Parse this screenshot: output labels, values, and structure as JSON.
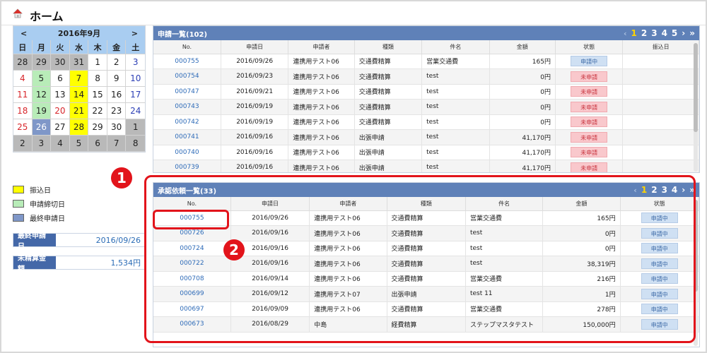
{
  "header": {
    "title": "ホーム"
  },
  "calendar": {
    "prev": "<",
    "title": "2016年9月",
    "next": ">",
    "dows": [
      "日",
      "月",
      "火",
      "水",
      "木",
      "金",
      "土"
    ],
    "cells": [
      {
        "d": "28",
        "bg": "gray",
        "t": ""
      },
      {
        "d": "29",
        "bg": "gray",
        "t": ""
      },
      {
        "d": "30",
        "bg": "gray",
        "t": ""
      },
      {
        "d": "31",
        "bg": "gray",
        "t": ""
      },
      {
        "d": "1",
        "bg": "",
        "t": ""
      },
      {
        "d": "2",
        "bg": "",
        "t": ""
      },
      {
        "d": "3",
        "bg": "",
        "t": "blue"
      },
      {
        "d": "4",
        "bg": "",
        "t": "red"
      },
      {
        "d": "5",
        "bg": "green",
        "t": ""
      },
      {
        "d": "6",
        "bg": "",
        "t": ""
      },
      {
        "d": "7",
        "bg": "yellow",
        "t": ""
      },
      {
        "d": "8",
        "bg": "",
        "t": ""
      },
      {
        "d": "9",
        "bg": "",
        "t": ""
      },
      {
        "d": "10",
        "bg": "",
        "t": "blue"
      },
      {
        "d": "11",
        "bg": "",
        "t": "red"
      },
      {
        "d": "12",
        "bg": "green",
        "t": ""
      },
      {
        "d": "13",
        "bg": "",
        "t": ""
      },
      {
        "d": "14",
        "bg": "yellow",
        "t": ""
      },
      {
        "d": "15",
        "bg": "",
        "t": ""
      },
      {
        "d": "16",
        "bg": "",
        "t": ""
      },
      {
        "d": "17",
        "bg": "",
        "t": "blue"
      },
      {
        "d": "18",
        "bg": "",
        "t": "red"
      },
      {
        "d": "19",
        "bg": "green",
        "t": ""
      },
      {
        "d": "20",
        "bg": "",
        "t": "red"
      },
      {
        "d": "21",
        "bg": "yellow",
        "t": ""
      },
      {
        "d": "22",
        "bg": "",
        "t": ""
      },
      {
        "d": "23",
        "bg": "",
        "t": ""
      },
      {
        "d": "24",
        "bg": "",
        "t": "blue"
      },
      {
        "d": "25",
        "bg": "",
        "t": "red"
      },
      {
        "d": "26",
        "bg": "blue",
        "t": ""
      },
      {
        "d": "27",
        "bg": "",
        "t": ""
      },
      {
        "d": "28",
        "bg": "yellow",
        "t": ""
      },
      {
        "d": "29",
        "bg": "",
        "t": ""
      },
      {
        "d": "30",
        "bg": "",
        "t": ""
      },
      {
        "d": "1",
        "bg": "gray",
        "t": ""
      },
      {
        "d": "2",
        "bg": "gray",
        "t": ""
      },
      {
        "d": "3",
        "bg": "gray",
        "t": ""
      },
      {
        "d": "4",
        "bg": "gray",
        "t": ""
      },
      {
        "d": "5",
        "bg": "gray",
        "t": ""
      },
      {
        "d": "6",
        "bg": "gray",
        "t": ""
      },
      {
        "d": "7",
        "bg": "gray",
        "t": ""
      },
      {
        "d": "8",
        "bg": "gray",
        "t": ""
      }
    ]
  },
  "legend": [
    {
      "label": "振込日",
      "color": "#ffff00"
    },
    {
      "label": "申請締切日",
      "color": "#b8ecb8"
    },
    {
      "label": "最終申請日",
      "color": "#7f97c8"
    }
  ],
  "info": {
    "last_applied_label": "最終申請日",
    "last_applied_value": "2016/09/26",
    "unsettled_label": "未精算金額",
    "unsettled_value": "1,534円"
  },
  "applications": {
    "title": "申請一覧(102)",
    "pager": [
      "‹",
      "1",
      "2",
      "3",
      "4",
      "5",
      "›",
      "»"
    ],
    "columns": [
      "No.",
      "申請日",
      "申請者",
      "種類",
      "件名",
      "金額",
      "状態",
      "振込日"
    ],
    "rows": [
      {
        "no": "000755",
        "date": "2016/09/26",
        "applicant": "連携用テスト06",
        "type": "交通費精算",
        "subject": "営業交通費",
        "amount": "165円",
        "status": "申請中",
        "st": "blue",
        "pay": ""
      },
      {
        "no": "000754",
        "date": "2016/09/23",
        "applicant": "連携用テスト06",
        "type": "交通費精算",
        "subject": "test",
        "amount": "0円",
        "status": "未申請",
        "st": "pink",
        "pay": ""
      },
      {
        "no": "000747",
        "date": "2016/09/21",
        "applicant": "連携用テスト06",
        "type": "交通費精算",
        "subject": "test",
        "amount": "0円",
        "status": "未申請",
        "st": "pink",
        "pay": ""
      },
      {
        "no": "000743",
        "date": "2016/09/19",
        "applicant": "連携用テスト06",
        "type": "交通費精算",
        "subject": "test",
        "amount": "0円",
        "status": "未申請",
        "st": "pink",
        "pay": ""
      },
      {
        "no": "000742",
        "date": "2016/09/19",
        "applicant": "連携用テスト06",
        "type": "交通費精算",
        "subject": "test",
        "amount": "0円",
        "status": "未申請",
        "st": "pink",
        "pay": ""
      },
      {
        "no": "000741",
        "date": "2016/09/16",
        "applicant": "連携用テスト06",
        "type": "出張申請",
        "subject": "test",
        "amount": "41,170円",
        "status": "未申請",
        "st": "pink",
        "pay": ""
      },
      {
        "no": "000740",
        "date": "2016/09/16",
        "applicant": "連携用テスト06",
        "type": "出張申請",
        "subject": "test",
        "amount": "41,170円",
        "status": "未申請",
        "st": "pink",
        "pay": ""
      },
      {
        "no": "000739",
        "date": "2016/09/16",
        "applicant": "連携用テスト06",
        "type": "出張申請",
        "subject": "test",
        "amount": "41,170円",
        "status": "未申請",
        "st": "pink",
        "pay": ""
      }
    ]
  },
  "approvals": {
    "title": "承認依頼一覧(33)",
    "pager": [
      "‹",
      "1",
      "2",
      "3",
      "4",
      "›",
      "»"
    ],
    "columns": [
      "No.",
      "申請日",
      "申請者",
      "種類",
      "件名",
      "金額",
      "状態"
    ],
    "rows": [
      {
        "no": "000755",
        "date": "2016/09/26",
        "applicant": "連携用テスト06",
        "type": "交通費精算",
        "subject": "営業交通費",
        "amount": "165円",
        "status": "申請中"
      },
      {
        "no": "000726",
        "date": "2016/09/16",
        "applicant": "連携用テスト06",
        "type": "交通費精算",
        "subject": "test",
        "amount": "0円",
        "status": "申請中"
      },
      {
        "no": "000724",
        "date": "2016/09/16",
        "applicant": "連携用テスト06",
        "type": "交通費精算",
        "subject": "test",
        "amount": "0円",
        "status": "申請中"
      },
      {
        "no": "000722",
        "date": "2016/09/16",
        "applicant": "連携用テスト06",
        "type": "交通費精算",
        "subject": "test",
        "amount": "38,319円",
        "status": "申請中"
      },
      {
        "no": "000708",
        "date": "2016/09/14",
        "applicant": "連携用テスト06",
        "type": "交通費精算",
        "subject": "営業交通費",
        "amount": "216円",
        "status": "申請中"
      },
      {
        "no": "000699",
        "date": "2016/09/12",
        "applicant": "連携用テスト07",
        "type": "出張申請",
        "subject": "test 11",
        "amount": "1円",
        "status": "申請中"
      },
      {
        "no": "000697",
        "date": "2016/09/09",
        "applicant": "連携用テスト06",
        "type": "交通費精算",
        "subject": "営業交通費",
        "amount": "278円",
        "status": "申請中"
      },
      {
        "no": "000673",
        "date": "2016/08/29",
        "applicant": "中島",
        "type": "経費精算",
        "subject": "ステップマスタテスト",
        "amount": "150,000円",
        "status": "申請中"
      }
    ]
  },
  "annotations": {
    "badge1": "1",
    "badge2": "2"
  },
  "colors": {
    "header_blue": "#5f81b8",
    "calendar_blue": "#a9cdf1",
    "annotation_red": "#e2141b"
  },
  "icons": {
    "home": "home-icon",
    "prev": "chevron-left-icon",
    "next": "chevron-right-icon"
  }
}
